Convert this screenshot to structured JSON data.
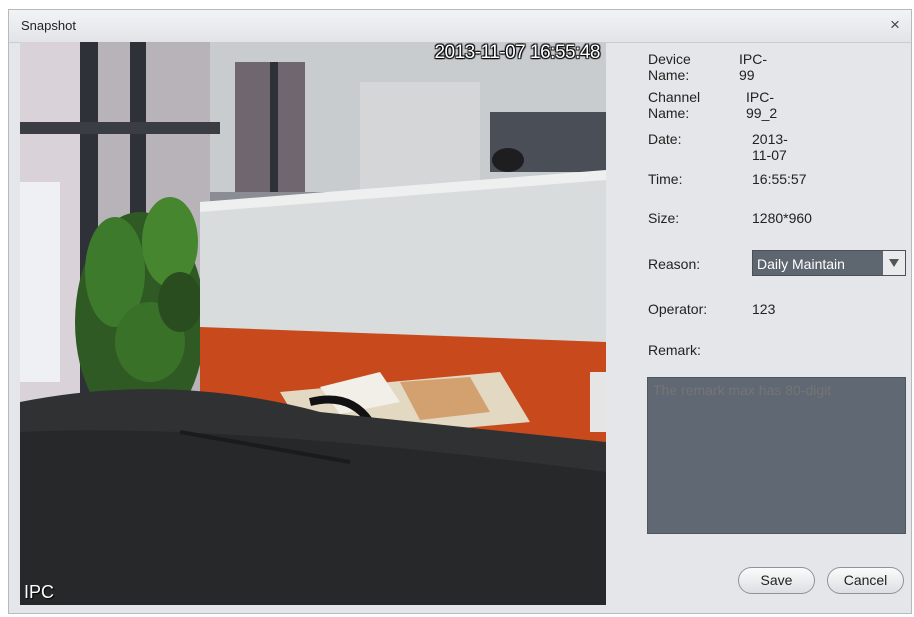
{
  "dialog": {
    "title": "Snapshot",
    "close_glyph": "×"
  },
  "video": {
    "timestamp": "2013-11-07 16:55:48",
    "channel_label": "IPC"
  },
  "info": {
    "device_name_label": "Device Name:",
    "device_name_value": "IPC-99",
    "channel_name_label": "Channel Name:",
    "channel_name_value": "IPC-99_2",
    "date_label": "Date:",
    "date_value": "2013-11-07",
    "time_label": "Time:",
    "time_value": "16:55:57",
    "size_label": "Size:",
    "size_value": "1280*960",
    "reason_label": "Reason:",
    "reason_value": "Daily Maintain",
    "operator_label": "Operator:",
    "operator_value": "123",
    "remark_label": "Remark:",
    "remark_placeholder": "The remark max has 80-digit"
  },
  "buttons": {
    "save": "Save",
    "cancel": "Cancel"
  }
}
